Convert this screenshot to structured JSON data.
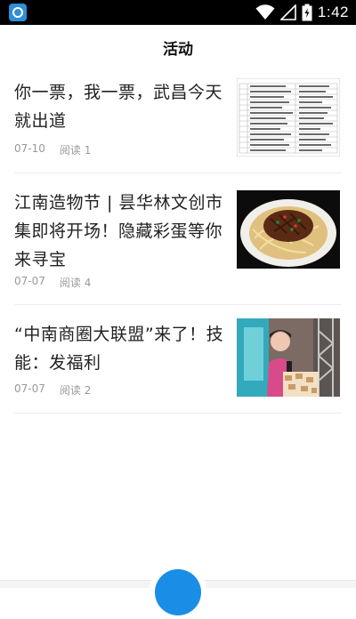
{
  "status_bar": {
    "time": "1:42",
    "icons": [
      "app-icon",
      "wifi-icon",
      "signal-icon",
      "battery-icon"
    ]
  },
  "header": {
    "title": "活动"
  },
  "articles": [
    {
      "title": "你一票，我一票，武昌今天就出道",
      "date": "07-10",
      "reads": "阅读 1",
      "thumb": "document-table-thumbnail"
    },
    {
      "title": "江南造物节 | 昙华林文创市集即将开场！隐藏彩蛋等你来寻宝",
      "date": "07-07",
      "reads": "阅读 4",
      "thumb": "food-noodles-thumbnail"
    },
    {
      "title": "“中南商圈大联盟”来了！技能：发福利",
      "date": "07-07",
      "reads": "阅读 2",
      "thumb": "event-stage-thumbnail"
    }
  ],
  "colors": {
    "accent": "#1a8ee6",
    "meta_text": "#9a9a9a",
    "title_text": "#222222"
  }
}
